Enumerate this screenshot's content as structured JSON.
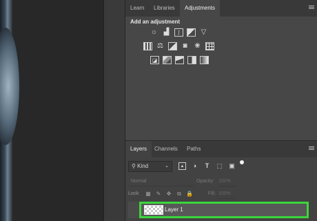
{
  "adjust_panel": {
    "tabs": [
      "Learn",
      "Libraries",
      "Adjustments"
    ],
    "active_tab": "Adjustments",
    "title": "Add an adjustment",
    "icons_row1": [
      "brightness-contrast-icon",
      "levels-icon",
      "curves-icon",
      "exposure-icon",
      "vibrance-icon"
    ],
    "icons_row2": [
      "hue-saturation-icon",
      "color-balance-icon",
      "black-white-icon",
      "photo-filter-icon",
      "channel-mixer-icon",
      "color-lookup-icon"
    ],
    "icons_row3": [
      "invert-icon",
      "posterize-icon",
      "threshold-icon",
      "selective-color-icon",
      "gradient-map-icon"
    ]
  },
  "layers_panel": {
    "tabs": [
      "Layers",
      "Channels",
      "Paths"
    ],
    "active_tab": "Layers",
    "kind_label": "Kind",
    "blend_mode": "Normal",
    "opacity_label": "Opacity:",
    "opacity_value": "100%",
    "lock_label": "Lock:",
    "fill_label": "Fill:",
    "fill_value": "100%",
    "layers": [
      {
        "name": "Layer 1",
        "highlight_color": "#3cd63c"
      }
    ]
  },
  "colors": {
    "panel_bg": "#474747",
    "tabbar_bg": "#393939",
    "highlight": "#3cd63c"
  }
}
